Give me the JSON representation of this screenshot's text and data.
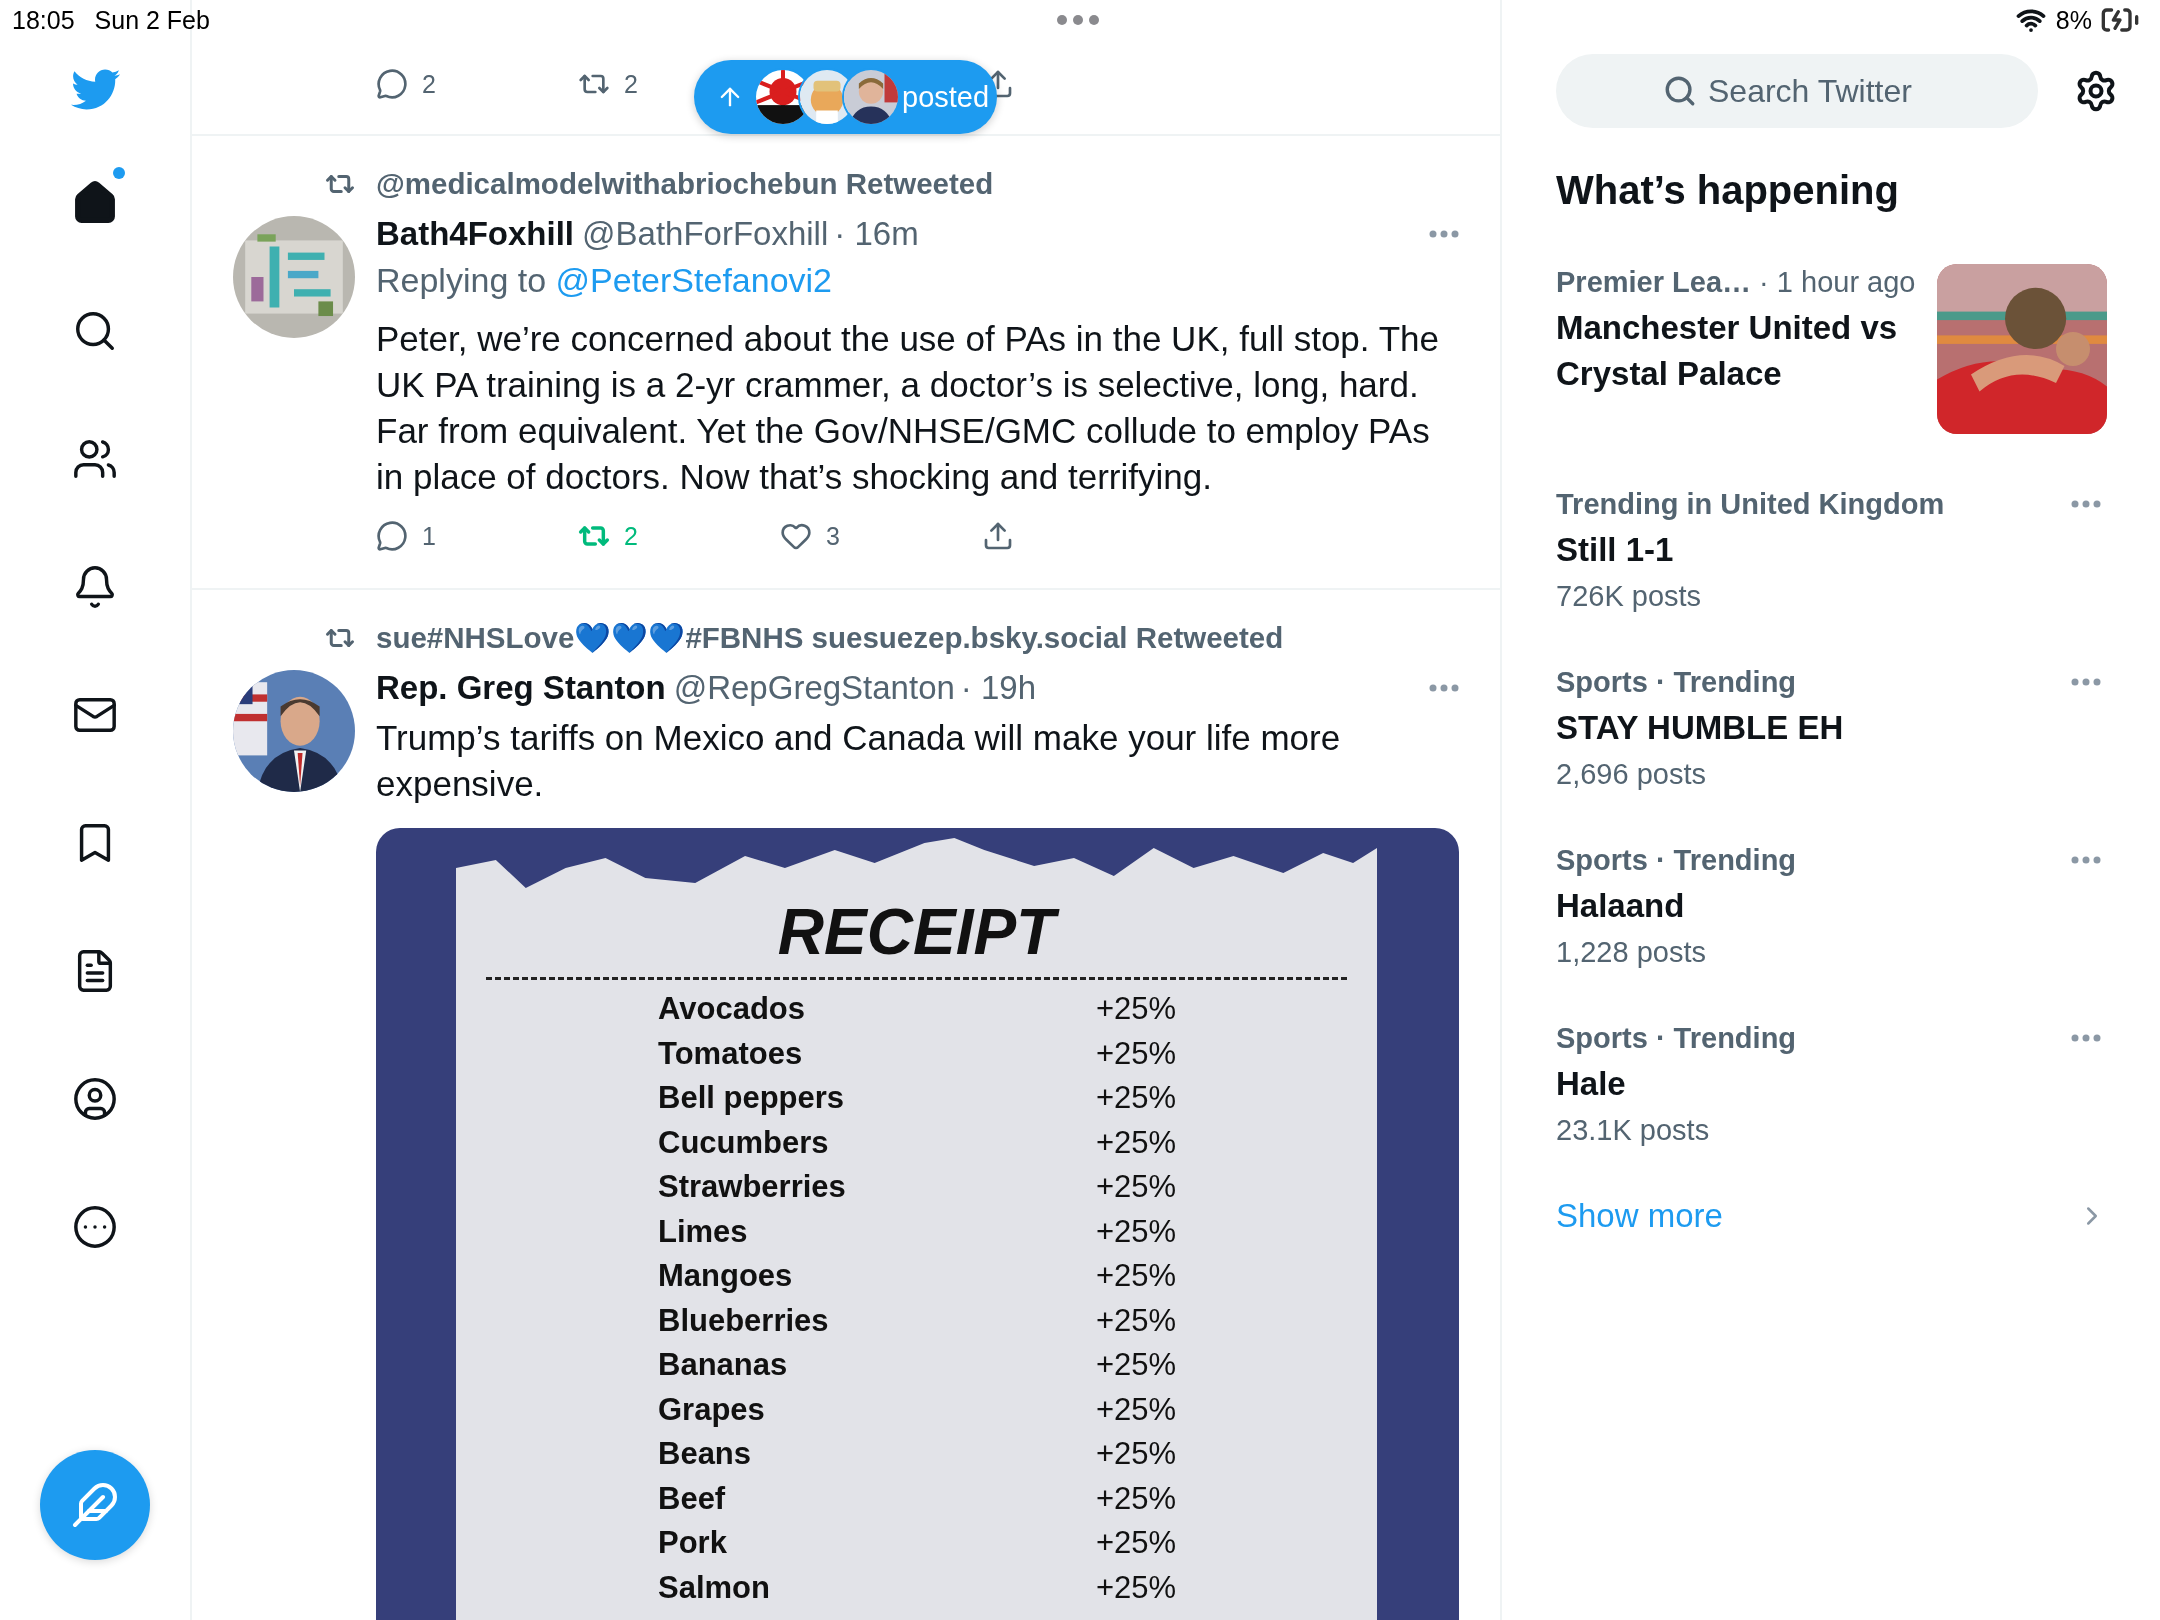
{
  "status_bar": {
    "time": "18:05",
    "date": "Sun 2 Feb",
    "battery": "8%"
  },
  "sidebar": {
    "items": [
      {
        "kind": "home",
        "selected": true,
        "unread": true
      },
      {
        "kind": "explore",
        "selected": false,
        "unread": false
      },
      {
        "kind": "communities",
        "selected": false,
        "unread": false
      },
      {
        "kind": "notifications",
        "selected": false,
        "unread": false
      },
      {
        "kind": "messages",
        "selected": false,
        "unread": false
      },
      {
        "kind": "bookmarks",
        "selected": false,
        "unread": false
      },
      {
        "kind": "lists",
        "selected": false,
        "unread": false
      },
      {
        "kind": "profile",
        "selected": false,
        "unread": false
      },
      {
        "kind": "more",
        "selected": false,
        "unread": false
      }
    ]
  },
  "feed": {
    "new_posts_pill": {
      "label": "posted"
    },
    "partial_tweet": {
      "actions": [
        {
          "kind": "reply",
          "count": "2",
          "active": false
        },
        {
          "kind": "retweet",
          "count": "2",
          "active": false
        },
        {
          "kind": "share",
          "active": false
        }
      ]
    },
    "tweets": [
      {
        "retweeted_by": "@medicalmodelwithabriochebun Retweeted",
        "name": "Bath4Foxhill",
        "handle": "@BathForFoxhill",
        "time": "· 16m",
        "reply_to": {
          "prefix": "Replying to",
          "handle": "@PeterStefanovi2"
        },
        "body": "Peter, we’re concerned about the use of PAs in the UK, full stop. The UK PA training is a 2-yr crammer,  a doctor’s is selective, long, hard. Far from equivalent.  Yet the Gov/NHSE/GMC collude to employ PAs in place of doctors. Now that’s shocking and terrifying.",
        "actions": [
          {
            "kind": "reply",
            "count": "1",
            "active": false
          },
          {
            "kind": "retweet",
            "count": "2",
            "active": true
          },
          {
            "kind": "like",
            "count": "3",
            "active": false
          },
          {
            "kind": "share",
            "active": false
          }
        ]
      },
      {
        "retweeted_by": "sue#NHSLove💙💙💙#FBNHS suesuezep.bsky.social Retweeted",
        "name": "Rep. Greg Stanton",
        "handle": "@RepGregStanton",
        "time": "· 19h",
        "body": "Trump’s tariffs on Mexico and Canada will make your life more expensive.",
        "media": {
          "kind": "receipt",
          "title": "RECEIPT",
          "items": [
            {
              "name": "Avocados",
              "change": "+25%"
            },
            {
              "name": "Tomatoes",
              "change": "+25%"
            },
            {
              "name": "Bell peppers",
              "change": "+25%"
            },
            {
              "name": "Cucumbers",
              "change": "+25%"
            },
            {
              "name": "Strawberries",
              "change": "+25%"
            },
            {
              "name": "Limes",
              "change": "+25%"
            },
            {
              "name": "Mangoes",
              "change": "+25%"
            },
            {
              "name": "Blueberries",
              "change": "+25%"
            },
            {
              "name": "Bananas",
              "change": "+25%"
            },
            {
              "name": "Grapes",
              "change": "+25%"
            },
            {
              "name": "Beans",
              "change": "+25%"
            },
            {
              "name": "Beef",
              "change": "+25%"
            },
            {
              "name": "Pork",
              "change": "+25%"
            },
            {
              "name": "Salmon",
              "change": "+25%"
            }
          ]
        }
      }
    ]
  },
  "right_panel": {
    "search": {
      "placeholder": "Search Twitter"
    },
    "heading": "What’s happening",
    "trends": [
      {
        "kind": "featured",
        "category": "Premier Lea…",
        "time": "· 1 hour ago",
        "title": "Manchester United vs Crystal Palace"
      },
      {
        "kind": "trend",
        "category": "Trending in United Kingdom",
        "title": "Still 1-1",
        "count": "726K posts"
      },
      {
        "kind": "trend",
        "category": "Sports · Trending",
        "title": "STAY HUMBLE EH",
        "count": "2,696 posts"
      },
      {
        "kind": "trend",
        "category": "Sports · Trending",
        "title": "Halaand",
        "count": "1,228 posts"
      },
      {
        "kind": "trend",
        "category": "Sports · Trending",
        "title": "Hale",
        "count": "23.1K posts"
      }
    ],
    "show_more": "Show more"
  }
}
